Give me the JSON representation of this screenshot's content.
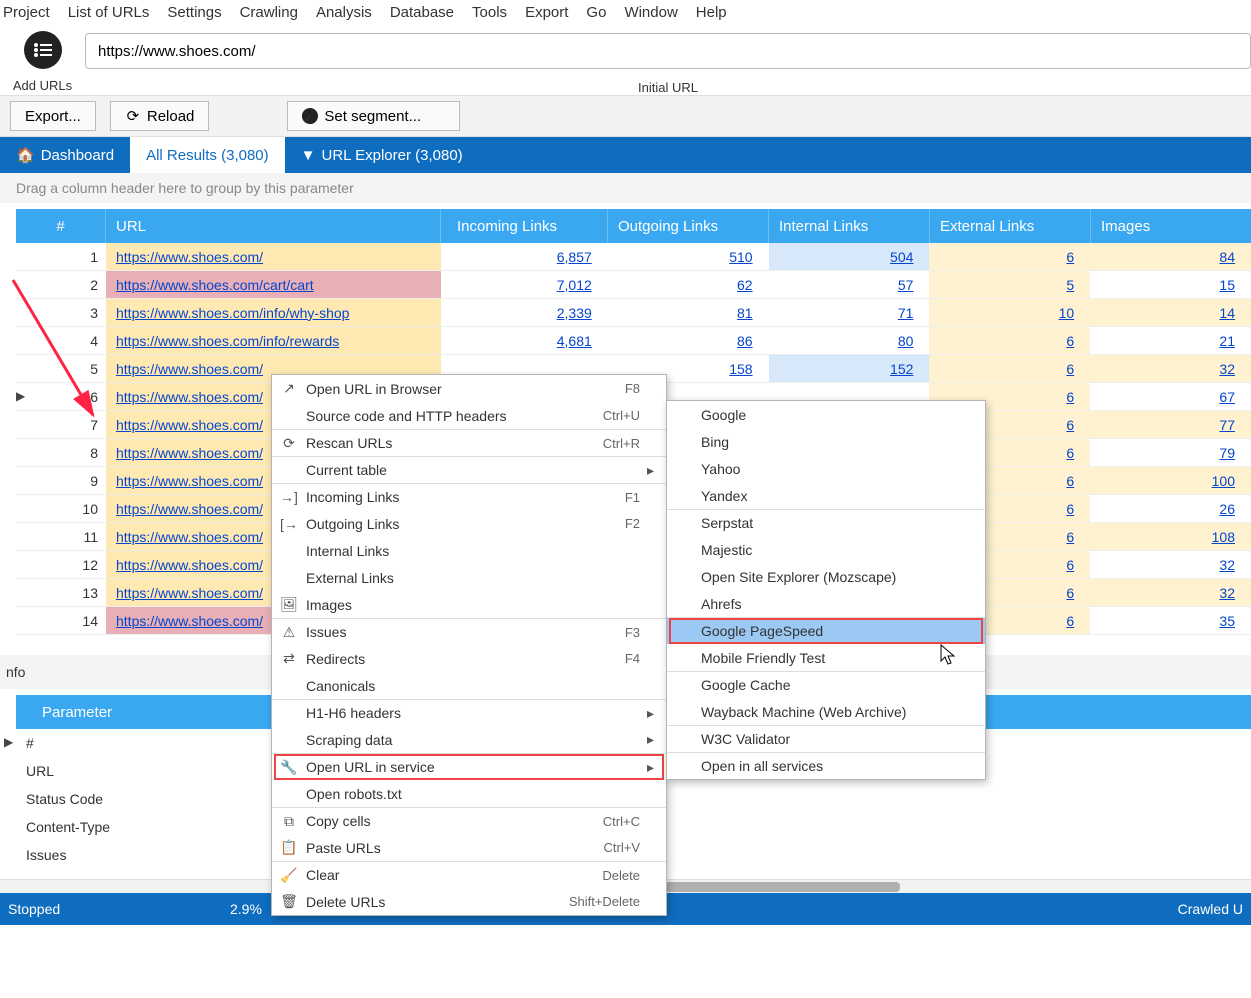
{
  "menubar": [
    "Project",
    "List of URLs",
    "Settings",
    "Crawling",
    "Analysis",
    "Database",
    "Tools",
    "Export",
    "Go",
    "Window",
    "Help"
  ],
  "url_input_value": "https://www.shoes.com/",
  "add_urls_label": "Add URLs",
  "initial_url_label": "Initial URL",
  "toolbar": {
    "export": "Export...",
    "reload": "Reload",
    "segment": "Set segment..."
  },
  "tabs": {
    "dashboard": "Dashboard",
    "all_results": "All Results (3,080)",
    "url_explorer": "URL Explorer  (3,080)"
  },
  "group_hint": "Drag a column header here to group by this parameter",
  "columns": {
    "num": "#",
    "url": "URL",
    "inc": "Incoming Links",
    "out": "Outgoing Links",
    "int": "Internal Links",
    "ext": "External Links",
    "img": "Images"
  },
  "rows": [
    {
      "n": 1,
      "url": "https://www.shoes.com/",
      "inc": "6,857",
      "out": "510",
      "int": "504",
      "ext": "6",
      "img": "84",
      "urlbg": "bg-ecru",
      "intbg": "bg-lightblue",
      "extbg": "bg-ecru-lt",
      "imgbg": "bg-ecru-lt"
    },
    {
      "n": 2,
      "url": "https://www.shoes.com/cart/cart",
      "inc": "7,012",
      "out": "62",
      "int": "57",
      "ext": "5",
      "img": "15",
      "urlbg": "bg-pink",
      "intbg": "bg-white",
      "extbg": "bg-ecru-lt",
      "imgbg": "bg-white"
    },
    {
      "n": 3,
      "url": "https://www.shoes.com/info/why-shop",
      "inc": "2,339",
      "out": "81",
      "int": "71",
      "ext": "10",
      "img": "14",
      "urlbg": "bg-ecru",
      "intbg": "bg-white",
      "extbg": "bg-ecru-lt",
      "imgbg": "bg-ecru-lt"
    },
    {
      "n": 4,
      "url": "https://www.shoes.com/info/rewards",
      "inc": "4,681",
      "out": "86",
      "int": "80",
      "ext": "6",
      "img": "21",
      "urlbg": "bg-ecru",
      "intbg": "bg-white",
      "extbg": "bg-ecru-lt",
      "imgbg": "bg-white"
    },
    {
      "n": 5,
      "url": "https://www.shoes.com/",
      "inc": "",
      "out": "158",
      "int": "152",
      "ext": "6",
      "img": "32",
      "urlbg": "bg-ecru",
      "intbg": "bg-lightblue",
      "extbg": "bg-ecru-lt",
      "imgbg": "bg-ecru-lt"
    },
    {
      "n": 6,
      "url": "https://www.shoes.com/",
      "inc": "",
      "out": "",
      "int": "",
      "ext": "6",
      "img": "67",
      "urlbg": "bg-ecru",
      "intbg": "",
      "extbg": "bg-ecru-lt",
      "imgbg": "bg-white"
    },
    {
      "n": 7,
      "url": "https://www.shoes.com/",
      "inc": "",
      "out": "",
      "int": "",
      "ext": "6",
      "img": "77",
      "urlbg": "bg-ecru",
      "intbg": "",
      "extbg": "bg-ecru-lt",
      "imgbg": "bg-ecru-lt"
    },
    {
      "n": 8,
      "url": "https://www.shoes.com/",
      "inc": "",
      "out": "",
      "int": "",
      "ext": "6",
      "img": "79",
      "urlbg": "bg-ecru",
      "intbg": "",
      "extbg": "bg-ecru-lt",
      "imgbg": "bg-white"
    },
    {
      "n": 9,
      "url": "https://www.shoes.com/",
      "inc": "",
      "out": "",
      "int": "",
      "ext": "6",
      "img": "100",
      "urlbg": "bg-ecru",
      "intbg": "",
      "extbg": "bg-ecru-lt",
      "imgbg": "bg-ecru-lt"
    },
    {
      "n": 10,
      "url": "https://www.shoes.com/",
      "inc": "",
      "out": "",
      "int": "",
      "ext": "6",
      "img": "26",
      "urlbg": "bg-ecru",
      "intbg": "",
      "extbg": "bg-ecru-lt",
      "imgbg": "bg-white"
    },
    {
      "n": 11,
      "url": "https://www.shoes.com/",
      "inc": "",
      "out": "",
      "int": "",
      "ext": "6",
      "img": "108",
      "urlbg": "bg-ecru",
      "intbg": "",
      "extbg": "bg-ecru-lt",
      "imgbg": "bg-ecru-lt"
    },
    {
      "n": 12,
      "url": "https://www.shoes.com/",
      "inc": "",
      "out": "",
      "int": "",
      "ext": "6",
      "img": "32",
      "urlbg": "bg-ecru",
      "intbg": "",
      "extbg": "bg-ecru-lt",
      "imgbg": "bg-white"
    },
    {
      "n": 13,
      "url": "https://www.shoes.com/",
      "inc": "",
      "out": "",
      "int": "",
      "ext": "6",
      "img": "32",
      "urlbg": "bg-ecru",
      "intbg": "",
      "extbg": "bg-ecru-lt",
      "imgbg": "bg-ecru-lt"
    },
    {
      "n": 14,
      "url": "https://www.shoes.com/",
      "inc": "",
      "out": "",
      "int": "",
      "ext": "6",
      "img": "35",
      "urlbg": "bg-pink",
      "intbg": "",
      "extbg": "bg-ecru-lt",
      "imgbg": "bg-white"
    }
  ],
  "info_title": "nfo",
  "info_header": "Parameter",
  "info_rows": [
    "#",
    "URL",
    "Status Code",
    "Content-Type",
    "Issues"
  ],
  "status": {
    "left": "Stopped",
    "pct": "2.9%",
    "right": "Crawled U"
  },
  "ctx_main": [
    {
      "ico": "↗",
      "label": "Open URL in Browser",
      "key": "F8"
    },
    {
      "ico": "</>",
      "label": "Source code and HTTP headers",
      "key": "Ctrl+U"
    },
    {
      "ico": "⟳",
      "label": "Rescan URLs",
      "key": "Ctrl+R",
      "sep": true
    },
    {
      "ico": "",
      "label": "Current table",
      "sub": true,
      "sep": true
    },
    {
      "ico": "→]",
      "label": "Incoming Links",
      "key": "F1",
      "sep": true
    },
    {
      "ico": "[→",
      "label": "Outgoing Links",
      "key": "F2"
    },
    {
      "ico": "",
      "label": "Internal Links"
    },
    {
      "ico": "",
      "label": "External Links"
    },
    {
      "ico": "🖼",
      "label": "Images"
    },
    {
      "ico": "⚠",
      "label": "Issues",
      "key": "F3",
      "sep": true
    },
    {
      "ico": "⇄",
      "label": "Redirects",
      "key": "F4"
    },
    {
      "ico": "",
      "label": "Canonicals"
    },
    {
      "ico": "",
      "label": "H1-H6 headers",
      "sub": true,
      "sep": true
    },
    {
      "ico": "",
      "label": "Scraping data",
      "sub": true
    },
    {
      "ico": "🔧",
      "label": "Open URL in service",
      "sub": true,
      "boxed": true,
      "sep": true
    },
    {
      "ico": "",
      "label": "Open robots.txt"
    },
    {
      "ico": "⧉",
      "label": "Copy cells",
      "key": "Ctrl+C",
      "sep": true
    },
    {
      "ico": "📋",
      "label": "Paste URLs",
      "key": "Ctrl+V"
    },
    {
      "ico": "🧹",
      "label": "Clear",
      "key": "Delete",
      "sep": true
    },
    {
      "ico": "🗑",
      "label": "Delete URLs",
      "key": "Shift+Delete"
    }
  ],
  "ctx_sub": [
    {
      "label": "Google"
    },
    {
      "label": "Bing"
    },
    {
      "label": "Yahoo"
    },
    {
      "label": "Yandex"
    },
    {
      "label": "Serpstat",
      "sep": true
    },
    {
      "label": "Majestic"
    },
    {
      "label": "Open Site Explorer (Mozscape)"
    },
    {
      "label": "Ahrefs"
    },
    {
      "label": "Google PageSpeed",
      "hl": true,
      "sep": true
    },
    {
      "label": "Mobile Friendly Test"
    },
    {
      "label": "Google Cache",
      "sep": true
    },
    {
      "label": "Wayback Machine (Web Archive)"
    },
    {
      "label": "W3C Validator",
      "sep": true
    },
    {
      "label": "Open in all services",
      "sep": true
    }
  ]
}
